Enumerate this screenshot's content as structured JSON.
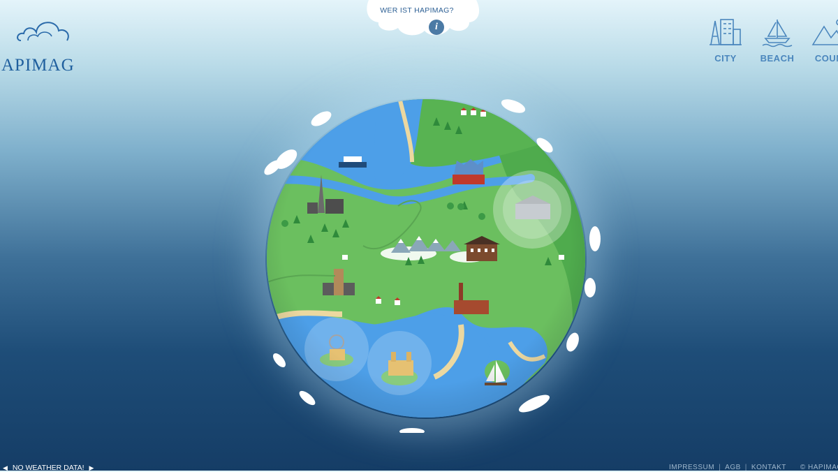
{
  "brand": {
    "logo_text": "APIMAG"
  },
  "info": {
    "title": "WER IST HAPIMAG?",
    "icon": "info-icon"
  },
  "categories": [
    {
      "label": "CITY",
      "icon": "city-icon"
    },
    {
      "label": "BEACH",
      "icon": "sailboat-icon"
    },
    {
      "label": "COUN",
      "icon": "mountain-icon"
    }
  ],
  "weather": {
    "status": "NO WEATHER DATA!",
    "prev": "previous-arrow-icon",
    "next": "next-arrow-icon"
  },
  "footer": {
    "impressum": "IMPRESSUM",
    "agb": "AGB",
    "kontakt": "KONTAKT",
    "copyright": "© HAPIMAG"
  },
  "colors": {
    "accent": "#4a86bd",
    "ocean": "#4d9fe8",
    "land": "#6bbf5f",
    "forest": "#4fab4d",
    "sand": "#ecd8a0"
  }
}
